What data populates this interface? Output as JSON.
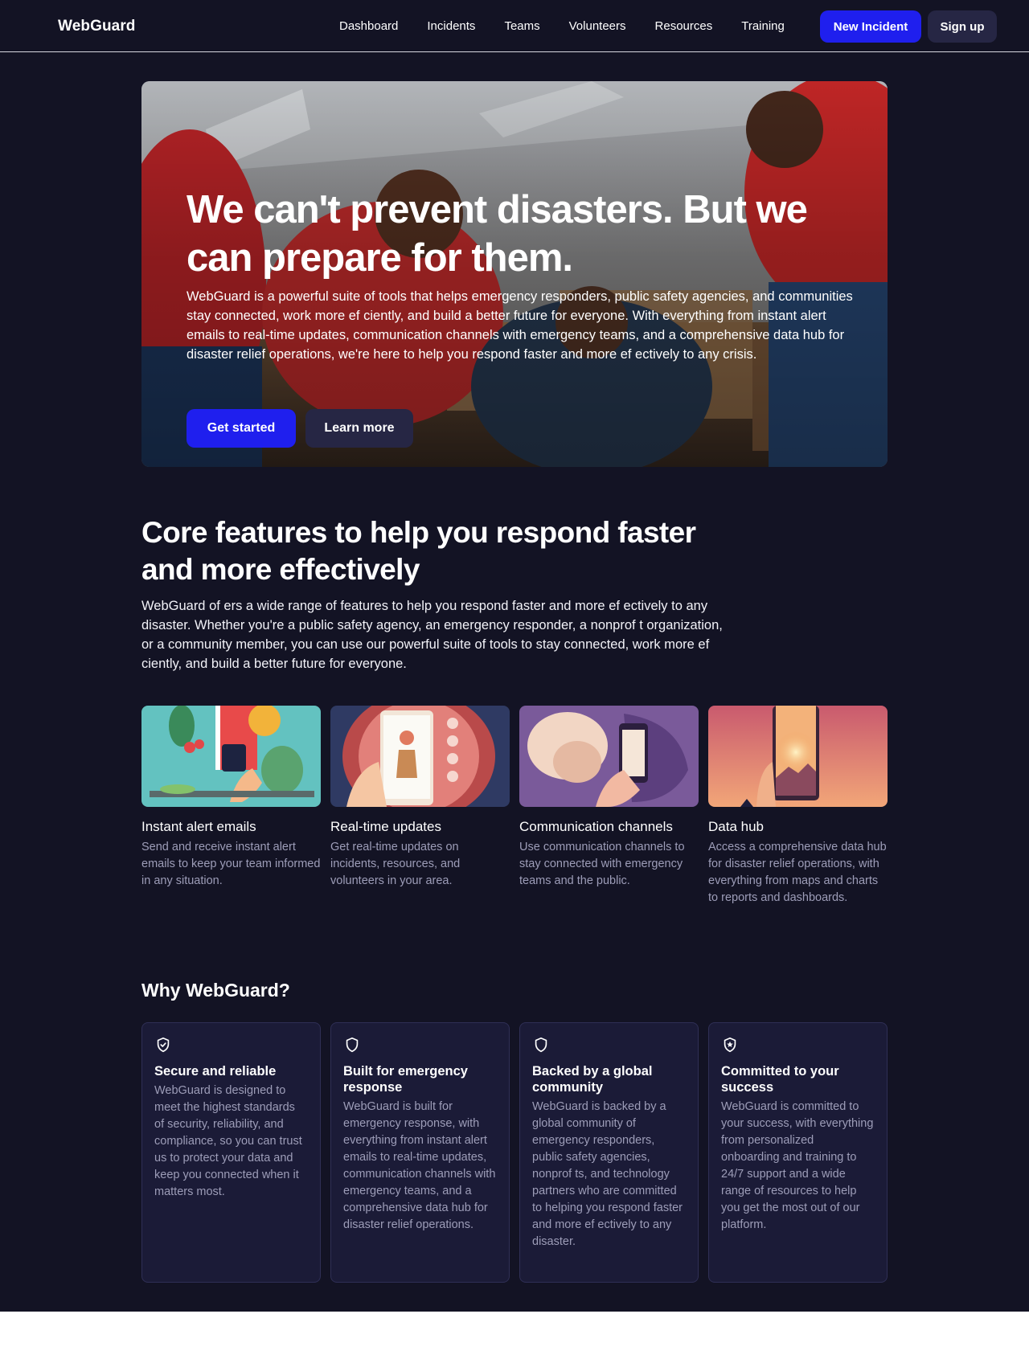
{
  "nav": {
    "brand": "WebGuard",
    "links": [
      "Dashboard",
      "Incidents",
      "Teams",
      "Volunteers",
      "Resources",
      "Training"
    ],
    "new_incident_label": "New Incident",
    "signup_label": "Sign up"
  },
  "hero": {
    "title": "We can't prevent disasters. But we can prepare for them.",
    "text": "WebGuard is a powerful suite of tools that helps emergency responders, public safety agencies, and communities stay connected, work more ef ciently, and build a better future for everyone. With everything from instant alert emails to real-time updates, communication channels with emergency teams, and a comprehensive data hub for disaster relief operations, we're here to help you respond faster and more ef ectively to any crisis.",
    "primary_label": "Get started",
    "secondary_label": "Learn more"
  },
  "core": {
    "title": "Core features to help you respond faster and more effectively",
    "text": "WebGuard of ers a wide range of features to help you respond faster and more ef ectively to any disaster. Whether you're a public safety agency, an emergency responder, a nonprof t organization, or a community member, you can use our powerful suite of tools to stay connected, work more ef ciently, and build a better future for everyone."
  },
  "features": [
    {
      "title": "Instant alert emails",
      "desc": "Send and receive instant alert emails to keep your team informed in any situation."
    },
    {
      "title": "Real-time updates",
      "desc": "Get real-time updates on incidents, resources, and volunteers in your area."
    },
    {
      "title": "Communication channels",
      "desc": "Use communication channels to stay connected with emergency teams and the public."
    },
    {
      "title": "Data hub",
      "desc": "Access a comprehensive data hub for disaster relief operations, with everything from maps and charts to reports and dashboards."
    }
  ],
  "why": {
    "title": "Why WebGuard?",
    "cards": [
      {
        "icon": "shield-check-icon",
        "title": "Secure and reliable",
        "desc": "WebGuard is designed to meet the highest standards of security, reliability, and compliance, so you can trust us to protect your data and keep you connected when it matters most."
      },
      {
        "icon": "shield-icon",
        "title": "Built for emergency response",
        "desc": "WebGuard is built for emergency response, with everything from instant alert emails to real-time updates, communication channels with emergency teams, and a comprehensive data hub for disaster relief operations."
      },
      {
        "icon": "shield-icon",
        "title": "Backed by a global community",
        "desc": "WebGuard is backed by a global community of emergency responders, public safety agencies, nonprof ts, and technology partners who are committed to helping you respond faster and more ef ectively to any disaster."
      },
      {
        "icon": "shield-star-icon",
        "title": "Committed to your success",
        "desc": "WebGuard is committed to your success, with everything from personalized onboarding and training to 24/7 support and a wide range of resources to help you get the most out of our platform."
      }
    ]
  },
  "colors": {
    "page_bg": "#131324",
    "accent": "#1f1fee",
    "secondary_button": "#262644",
    "card_bg": "#1b1b37",
    "muted_text": "#9d9db8"
  }
}
